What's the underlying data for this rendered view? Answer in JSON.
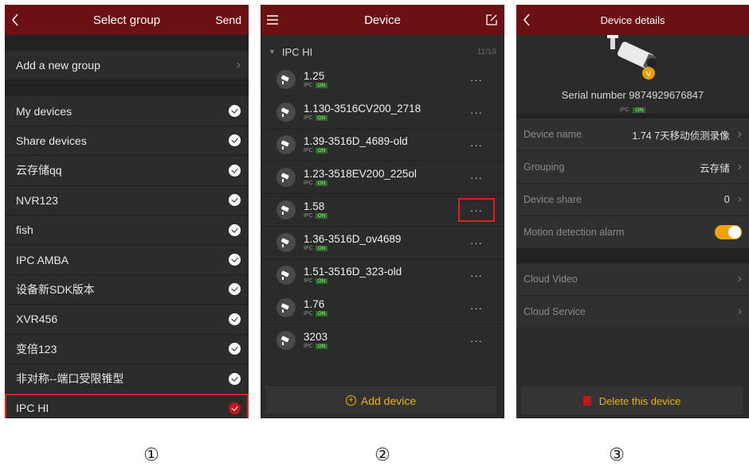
{
  "panel1": {
    "title": "Select group",
    "send": "Send",
    "add_group": "Add a new group",
    "groups": [
      {
        "label": "My devices",
        "checked": true
      },
      {
        "label": "Share devices",
        "checked": true
      },
      {
        "label": "云存储qq",
        "checked": true
      },
      {
        "label": "NVR123",
        "checked": true
      },
      {
        "label": "fish",
        "checked": true
      },
      {
        "label": "IPC AMBA",
        "checked": true
      },
      {
        "label": "设备新SDK版本",
        "checked": true
      },
      {
        "label": "XVR456",
        "checked": true
      },
      {
        "label": "变倍123",
        "checked": true
      },
      {
        "label": "非对称--端口受限锥型",
        "checked": true
      },
      {
        "label": "IPC HI",
        "checked": true,
        "selected": true
      }
    ]
  },
  "panel2": {
    "title": "Device",
    "group": {
      "name": "IPC HI",
      "count": "11/19"
    },
    "devices": [
      {
        "name": "1.25",
        "type": "IPC",
        "status": "ON"
      },
      {
        "name": "1.130-3516CV200_2718",
        "type": "IPC",
        "status": "ON"
      },
      {
        "name": "1.39-3516D_4689-old",
        "type": "IPC",
        "status": "ON"
      },
      {
        "name": "1.23-3518EV200_225ol",
        "type": "IPC",
        "status": "ON"
      },
      {
        "name": "1.58",
        "type": "IPC",
        "status": "ON",
        "highlight": true
      },
      {
        "name": "1.36-3516D_ov4689",
        "type": "IPC",
        "status": "ON"
      },
      {
        "name": "1.51-3516D_323-old",
        "type": "IPC",
        "status": "ON"
      },
      {
        "name": "1.76",
        "type": "IPC",
        "status": "ON"
      },
      {
        "name": "3203",
        "type": "IPC",
        "status": "ON"
      }
    ],
    "more": "···",
    "add_device": "Add device"
  },
  "panel3": {
    "title": "Device details",
    "serial": "Serial number 9874929676847",
    "type": "IPC",
    "status": "ON",
    "rows": [
      {
        "label": "Device name",
        "value": "1.74 7天移动侦测录像"
      },
      {
        "label": "Grouping",
        "value": "云存储"
      },
      {
        "label": "Device share",
        "value": "0"
      }
    ],
    "motion_label": "Motion detection alarm",
    "motion_on": true,
    "cloud_video": "Cloud Video",
    "cloud_service": "Cloud Service",
    "delete": "Delete this device"
  },
  "labels": [
    "①",
    "②",
    "③"
  ],
  "colors": {
    "header": "#6b1013",
    "accent": "#e8b400",
    "highlight": "#e02020"
  }
}
